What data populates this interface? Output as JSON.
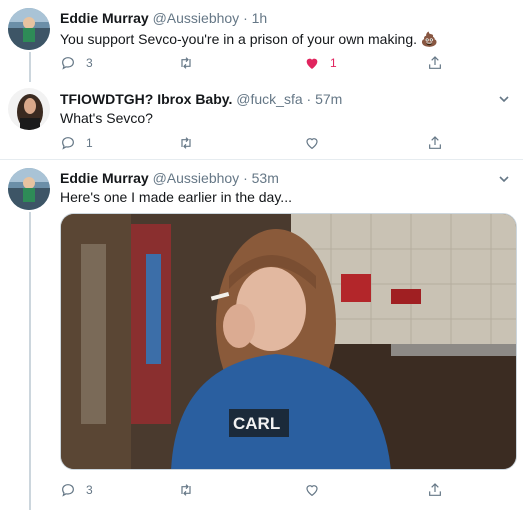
{
  "tweets": [
    {
      "name": "Eddie Murray",
      "handle": "@Aussiebhoy",
      "dot": "·",
      "time": "1h",
      "text": "You support Sevco-you're in a prison of your own making.",
      "emoji": "💩",
      "replies": "3",
      "retweets": "",
      "likes": "1",
      "liked": true
    },
    {
      "name": "TFIOWDTGH? Ibrox Baby.",
      "handle": "@fuck_sfa",
      "dot": "·",
      "time": "57m",
      "text": "What's Sevco?",
      "replies": "1",
      "retweets": "",
      "likes": ""
    },
    {
      "name": "Eddie Murray",
      "handle": "@Aussiebhoy",
      "dot": "·",
      "time": "53m",
      "text": "Here's one I made earlier in the day...",
      "replies": "3",
      "retweets": "",
      "likes": "",
      "photo_shirt_text": "CARL"
    }
  ],
  "colors": {
    "like_active": "#e0245e",
    "secondary_text": "#657786",
    "thread_line": "#ccd6dd"
  },
  "icons": [
    "reply-icon",
    "retweet-icon",
    "like-icon",
    "share-icon",
    "caret-down-icon"
  ]
}
